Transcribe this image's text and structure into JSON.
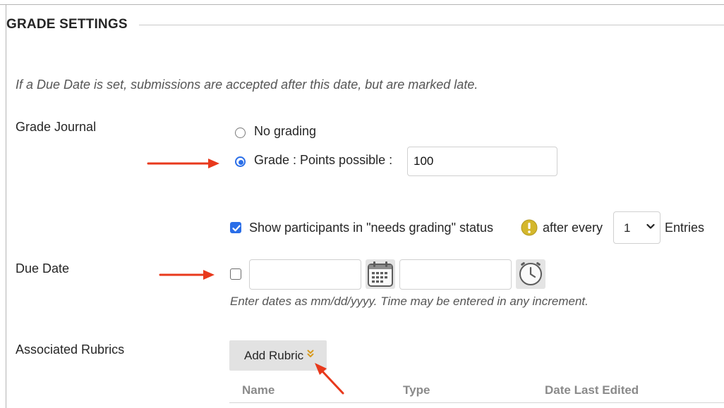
{
  "section": {
    "title": "GRADE SETTINGS"
  },
  "intro": "If a Due Date is set, submissions are accepted after this date, but are marked late.",
  "grade_journal": {
    "label": "Grade Journal",
    "no_grading_label": "No grading",
    "grade_label": "Grade : Points possible :",
    "points_value": "100",
    "selected": "grade"
  },
  "needs_grading": {
    "checked": true,
    "label": "Show participants in \"needs grading\" status",
    "after_every_label": "after every",
    "entries_value": "1",
    "entries_label": "Entries",
    "icon": "exclamation-icon"
  },
  "due_date": {
    "label": "Due Date",
    "checked": false,
    "date_value": "",
    "time_value": "",
    "calendar_icon": "calendar-icon",
    "clock_icon": "clock-icon",
    "hint": "Enter dates as mm/dd/yyyy. Time may be entered in any increment."
  },
  "rubrics": {
    "label": "Associated Rubrics",
    "add_button": "Add Rubric",
    "columns": [
      "Name",
      "Type",
      "Date Last Edited"
    ]
  },
  "colors": {
    "accent": "#2a6ee8",
    "annotation_arrow": "#e8391c",
    "warning": "#d4b72c"
  }
}
